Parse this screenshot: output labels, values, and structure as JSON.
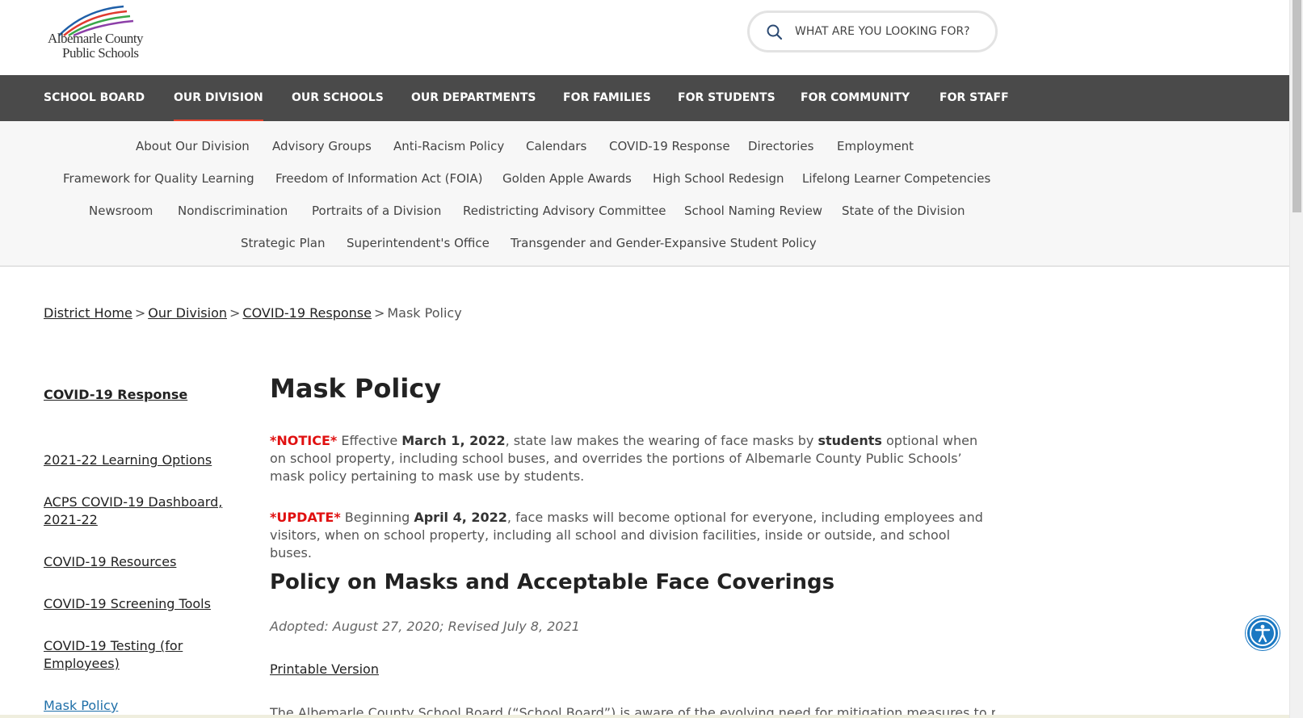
{
  "header": {
    "logo_line1": "Albemarle County",
    "logo_line2": "Public Schools",
    "search_placeholder": "WHAT ARE YOU LOOKING FOR?"
  },
  "main_nav": [
    "SCHOOL BOARD",
    "OUR DIVISION",
    "OUR SCHOOLS",
    "OUR DEPARTMENTS",
    "FOR FAMILIES",
    "FOR STUDENTS",
    "FOR COMMUNITY",
    "FOR STAFF"
  ],
  "main_nav_active": "OUR DIVISION",
  "sub_nav": [
    "About Our Division",
    "Advisory Groups",
    "Anti-Racism Policy",
    "Calendars",
    "COVID-19 Response",
    "Directories",
    "Employment",
    "Framework for Quality Learning",
    "Freedom of Information Act (FOIA)",
    "Golden Apple Awards",
    "High School Redesign",
    "Lifelong Learner Competencies",
    "Newsroom",
    "Nondiscrimination",
    "Portraits of a Division",
    "Redistricting Advisory Committee",
    "School Naming Review",
    "State of the Division",
    "Strategic Plan",
    "Superintendent's Office",
    "Transgender and Gender-Expansive Student Policy"
  ],
  "breadcrumb": {
    "items": [
      "District Home",
      "Our Division",
      "COVID-19 Response"
    ],
    "current": "Mask Policy",
    "separator": ">"
  },
  "side_nav": {
    "heading": "COVID-19 Response",
    "items": [
      "2021-22 Learning Options",
      "ACPS COVID-19 Dashboard, 2021-22",
      "COVID-19 Resources",
      "COVID-19 Screening Tools",
      "COVID-19 Testing (for Employees)",
      "Mask Policy"
    ]
  },
  "content": {
    "title": "Mask Policy",
    "notice": {
      "tag": "*NOTICE*",
      "t1": " Effective ",
      "date": "March 1, 2022",
      "t2": ", state law makes the wearing of face masks by ",
      "strong": "students",
      "t3": " optional when on school property, including school buses, and overrides the portions of Albemarle County Public Schools’ mask policy pertaining to mask use by students."
    },
    "update": {
      "tag": "*UPDATE*",
      "t1": " Beginning ",
      "date": "April 4, 2022",
      "t2": ", face masks will become optional for everyone, including employees and visitors, when on school property, including all school and division facilities, inside or outside, and school buses."
    },
    "subtitle": "Policy on Masks and Acceptable Face Coverings",
    "adopted": "Adopted: August 27, 2020; Revised July 8, 2021",
    "printable": "Printable Version",
    "body_start": "The Albemarle County School Board (“School Board”) is aware of the evolving need for mitigation measures to respond"
  },
  "colors": {
    "nav_bg": "#4a4a4a",
    "active_underline": "#e8422c",
    "notice_red": "#e01010",
    "accessibility_blue": "#1a78c2"
  }
}
